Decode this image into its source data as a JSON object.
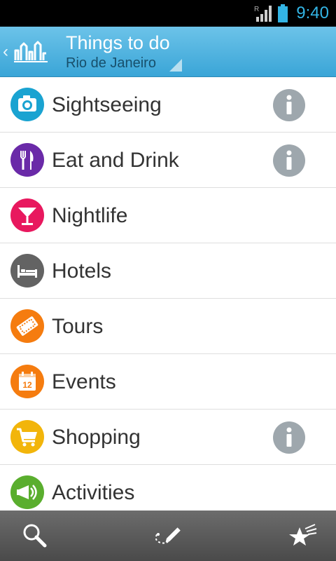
{
  "status_bar": {
    "time": "9:40",
    "signal_icon": "signal-roaming-icon",
    "battery_icon": "battery-icon",
    "accent_color": "#33b5e5"
  },
  "app_bar": {
    "title": "Things to do",
    "subtitle": "Rio de Janeiro",
    "back_icon": "chevron-left-icon",
    "logo_icon": "city-skyline-logo-icon",
    "dropdown_icon": "dropdown-triangle-icon",
    "color": "#4fb3e0"
  },
  "categories": [
    {
      "label": "Sightseeing",
      "icon": "camera-icon",
      "color": "#1aa3d1",
      "info": true
    },
    {
      "label": "Eat and Drink",
      "icon": "fork-knife-icon",
      "color": "#6a2aa8",
      "info": true
    },
    {
      "label": "Nightlife",
      "icon": "cocktail-icon",
      "color": "#e8185e",
      "info": false
    },
    {
      "label": "Hotels",
      "icon": "bed-icon",
      "color": "#636363",
      "info": false
    },
    {
      "label": "Tours",
      "icon": "ticket-icon",
      "color": "#f57c0f",
      "info": false
    },
    {
      "label": "Events",
      "icon": "calendar-icon",
      "color": "#f57c0f",
      "info": false
    },
    {
      "label": "Shopping",
      "icon": "shopping-cart-icon",
      "color": "#f2b50b",
      "info": true
    },
    {
      "label": "Activities",
      "icon": "megaphone-icon",
      "color": "#5aae2e",
      "info": false
    }
  ],
  "calendar_day": "12",
  "bottom_bar": {
    "items": [
      {
        "icon": "search-icon"
      },
      {
        "icon": "route-pen-icon"
      },
      {
        "icon": "favorite-stars-icon"
      }
    ]
  }
}
